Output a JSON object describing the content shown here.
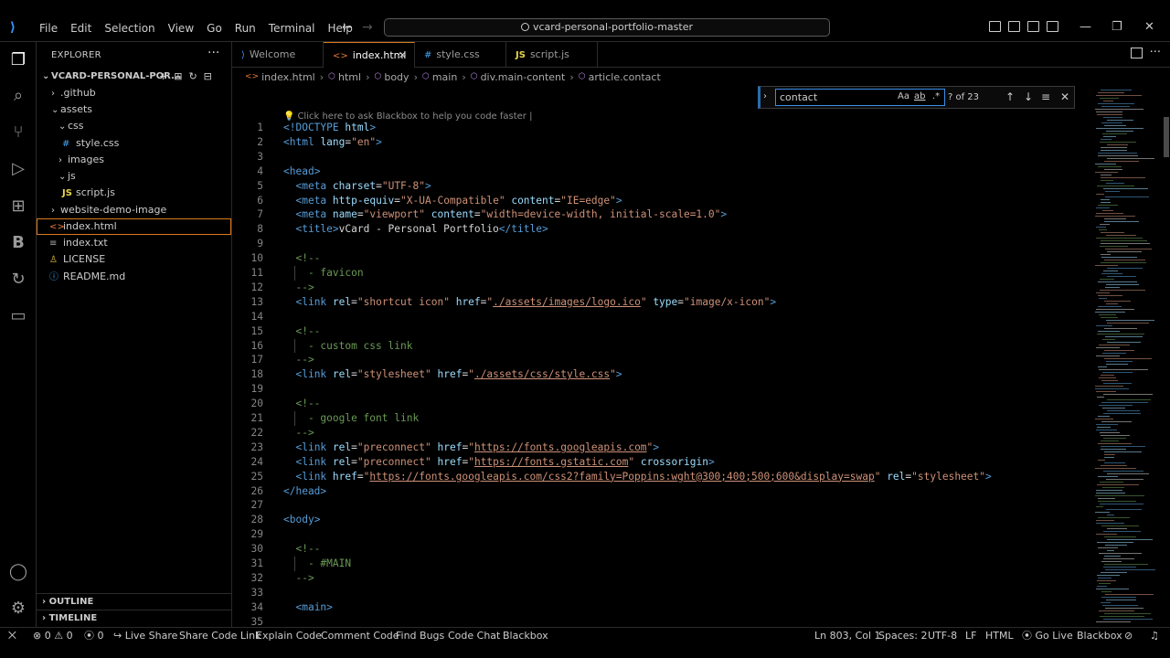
{
  "menu": [
    "File",
    "Edit",
    "Selection",
    "View",
    "Go",
    "Run",
    "Terminal",
    "Help"
  ],
  "command_center": "vcard-personal-portfolio-master",
  "explorer": {
    "title": "EXPLORER",
    "root": "VCARD-PERSONAL-POR...",
    "items": [
      {
        "label": ".github",
        "type": "folder",
        "open": false
      },
      {
        "label": "assets",
        "type": "folder",
        "open": true
      },
      {
        "label": "css",
        "type": "folder",
        "open": true
      },
      {
        "label": "style.css",
        "type": "css"
      },
      {
        "label": "images",
        "type": "folder",
        "open": false
      },
      {
        "label": "js",
        "type": "folder",
        "open": true
      },
      {
        "label": "script.js",
        "type": "js"
      },
      {
        "label": "website-demo-image",
        "type": "folder",
        "open": false
      },
      {
        "label": "index.html",
        "type": "html"
      },
      {
        "label": "index.txt",
        "type": "txt"
      },
      {
        "label": "LICENSE",
        "type": "license"
      },
      {
        "label": "README.md",
        "type": "md"
      }
    ],
    "outline": "OUTLINE",
    "timeline": "TIMELINE"
  },
  "tabs": [
    {
      "label": "Welcome",
      "icon": "vscode-icon"
    },
    {
      "label": "index.html",
      "icon": "html-icon",
      "active": true
    },
    {
      "label": "style.css",
      "icon": "css-icon"
    },
    {
      "label": "script.js",
      "icon": "js-icon"
    }
  ],
  "breadcrumb": [
    "index.html",
    "html",
    "body",
    "main",
    "div.main-content",
    "article.contact"
  ],
  "find": {
    "query": "contact",
    "count": "? of 23",
    "opt_case": "Aa",
    "opt_word": "ab",
    "opt_regex": ".*"
  },
  "hint": "Click here to ask Blackbox to help you code faster |",
  "code_lines": [
    {
      "n": "1",
      "t": "<!DOCTYPE html>"
    },
    {
      "n": "2",
      "t": "<html lang=\"en\">"
    },
    {
      "n": "3",
      "t": ""
    },
    {
      "n": "4",
      "t": "<head>"
    },
    {
      "n": "5",
      "t": "  <meta charset=\"UTF-8\">"
    },
    {
      "n": "6",
      "t": "  <meta http-equiv=\"X-UA-Compatible\" content=\"IE=edge\">"
    },
    {
      "n": "7",
      "t": "  <meta name=\"viewport\" content=\"width=device-width, initial-scale=1.0\">"
    },
    {
      "n": "8",
      "t": "  <title>vCard - Personal Portfolio</title>"
    },
    {
      "n": "9",
      "t": ""
    },
    {
      "n": "10",
      "t": "  <!--"
    },
    {
      "n": "11",
      "t": "    - favicon"
    },
    {
      "n": "12",
      "t": "  -->"
    },
    {
      "n": "13",
      "t": "  <link rel=\"shortcut icon\" href=\"./assets/images/logo.ico\" type=\"image/x-icon\">"
    },
    {
      "n": "14",
      "t": ""
    },
    {
      "n": "15",
      "t": "  <!--"
    },
    {
      "n": "16",
      "t": "    - custom css link"
    },
    {
      "n": "17",
      "t": "  -->"
    },
    {
      "n": "18",
      "t": "  <link rel=\"stylesheet\" href=\"./assets/css/style.css\">"
    },
    {
      "n": "19",
      "t": ""
    },
    {
      "n": "20",
      "t": "  <!--"
    },
    {
      "n": "21",
      "t": "    - google font link"
    },
    {
      "n": "22",
      "t": "  -->"
    },
    {
      "n": "23",
      "t": "  <link rel=\"preconnect\" href=\"https://fonts.googleapis.com\">"
    },
    {
      "n": "24",
      "t": "  <link rel=\"preconnect\" href=\"https://fonts.gstatic.com\" crossorigin>"
    },
    {
      "n": "25",
      "t": "  <link href=\"https://fonts.googleapis.com/css2?family=Poppins:wght@300;400;500;600&display=swap\" rel=\"stylesheet\">"
    },
    {
      "n": "26",
      "t": "</head>"
    },
    {
      "n": "27",
      "t": ""
    },
    {
      "n": "28",
      "t": "<body>"
    },
    {
      "n": "29",
      "t": ""
    },
    {
      "n": "30",
      "t": "  <!--"
    },
    {
      "n": "31",
      "t": "    - #MAIN"
    },
    {
      "n": "32",
      "t": "  -->"
    },
    {
      "n": "33",
      "t": ""
    },
    {
      "n": "34",
      "t": "  <main>"
    },
    {
      "n": "35",
      "t": ""
    }
  ],
  "status": {
    "errors": "0",
    "warnings": "0",
    "ports": "0",
    "left_items": [
      "Live Share",
      "Share Code Link",
      "Explain Code",
      "Comment Code",
      "Find Bugs",
      "Code Chat",
      "Blackbox"
    ],
    "position": "Ln 803, Col 1",
    "spaces": "Spaces: 2",
    "encoding": "UTF-8",
    "eol": "LF",
    "language": "HTML",
    "golive": "Go Live",
    "blackbox": "Blackbox"
  },
  "colors": {
    "accent": "#d97a1d",
    "tag": "#569cd6",
    "attr": "#9cdcfe",
    "string": "#ce9178",
    "comment": "#6a9955"
  }
}
